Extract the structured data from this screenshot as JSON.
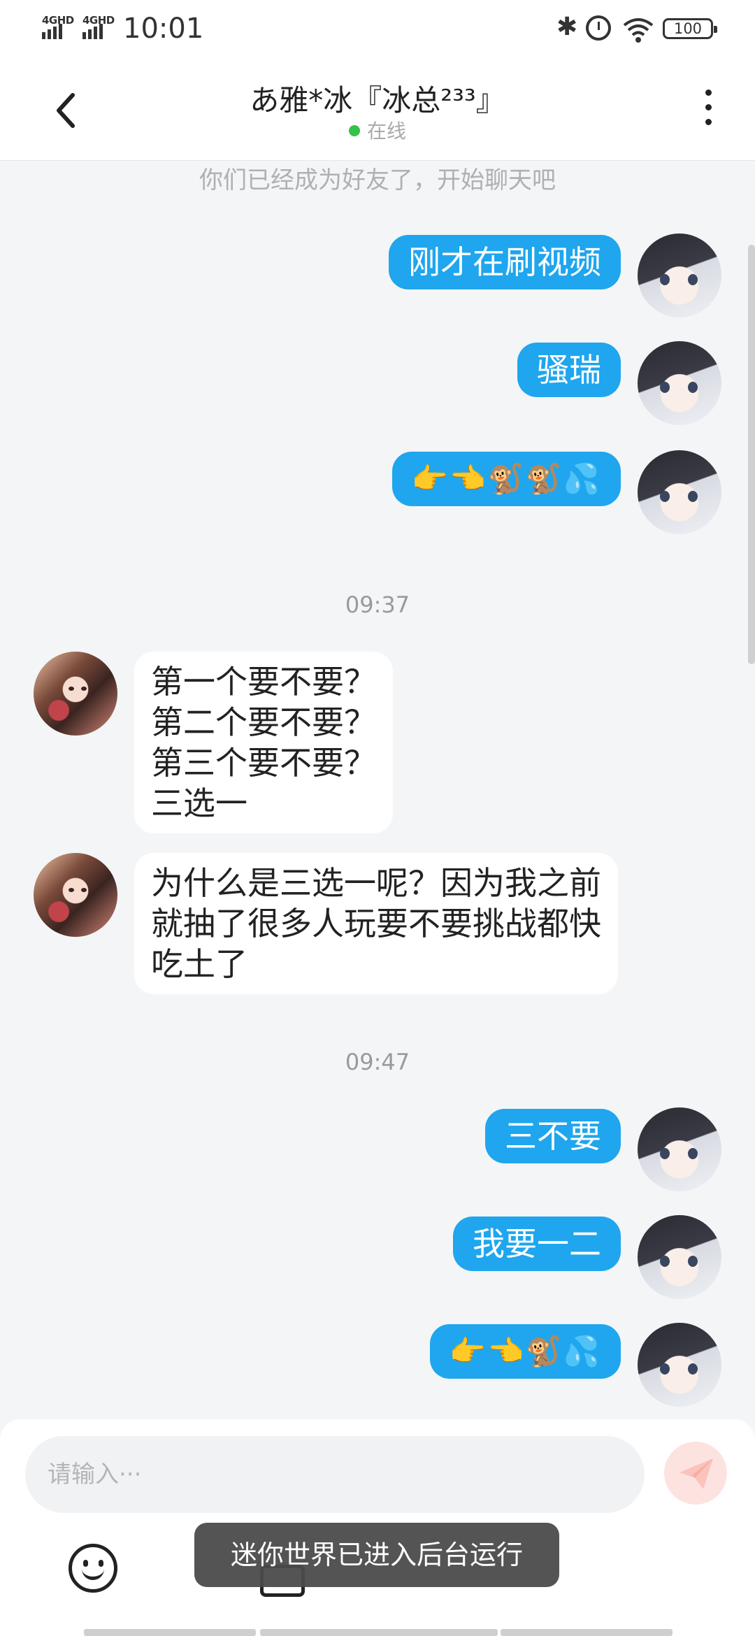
{
  "status_bar": {
    "network_1": "4GHD",
    "network_2": "4GHD",
    "time": "10:01",
    "battery": "100"
  },
  "header": {
    "title": "あ雅*冰『冰总²³³』",
    "status": "在线"
  },
  "chat": {
    "system_note": "你们已经成为好友了，开始聊天吧",
    "messages": [
      {
        "side": "out",
        "lines": [
          "刚才在刷视频"
        ]
      },
      {
        "side": "out",
        "lines": [
          "骚瑞"
        ]
      },
      {
        "side": "out",
        "lines": [
          "👉👈🐒🐒💦"
        ]
      },
      {
        "timestamp": "09:37"
      },
      {
        "side": "in",
        "lines": [
          "第一个要不要？",
          "第二个要不要？",
          "第三个要不要？",
          "三选一"
        ]
      },
      {
        "side": "in",
        "lines": [
          "为什么是三选一呢？因为我之前",
          "就抽了很多人玩要不要挑战都快",
          "吃土了"
        ]
      },
      {
        "timestamp": "09:47"
      },
      {
        "side": "out",
        "lines": [
          "三不要"
        ]
      },
      {
        "side": "out",
        "lines": [
          "我要一二"
        ]
      },
      {
        "side": "out",
        "lines": [
          "👉👈🐒💦"
        ]
      }
    ]
  },
  "input": {
    "placeholder": "请输入···"
  },
  "toast": "迷你世界已进入后台运行",
  "colors": {
    "outgoing_bubble": "#1fa6ee",
    "online_dot": "#33c24a",
    "background": "#f4f5f7"
  },
  "icons": {
    "back": "chevron-left-icon",
    "more": "more-vertical-icon",
    "send": "send-icon",
    "emoji": "smiley-icon",
    "image": "image-icon"
  }
}
